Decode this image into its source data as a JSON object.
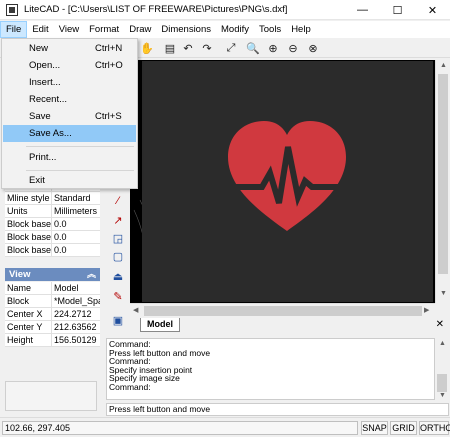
{
  "window": {
    "title": "LiteCAD - [C:\\Users\\LIST OF FREEWARE\\Pictures\\PNG\\s.dxf]",
    "minimize": "—",
    "maximize": "☐",
    "close": "✕"
  },
  "menubar": [
    "File",
    "Edit",
    "View",
    "Format",
    "Draw",
    "Dimensions",
    "Modify",
    "Tools",
    "Help"
  ],
  "file_menu": {
    "items": [
      {
        "label": "New",
        "shortcut": "Ctrl+N"
      },
      {
        "label": "Open...",
        "shortcut": "Ctrl+O"
      },
      {
        "label": "Insert...",
        "shortcut": ""
      },
      {
        "label": "Recent...",
        "shortcut": ""
      },
      {
        "label": "Save",
        "shortcut": "Ctrl+S"
      },
      {
        "label": "Save As...",
        "shortcut": ""
      },
      {
        "label": "Print...",
        "shortcut": ""
      },
      {
        "label": "Exit",
        "shortcut": ""
      }
    ],
    "highlighted": "Save As..."
  },
  "properties": {
    "rows_top": [
      {
        "key": "Mline style",
        "value": "Standard"
      },
      {
        "key": "Units",
        "value": "Millimeters"
      },
      {
        "key": "Block base",
        "value": "0.0"
      },
      {
        "key": "Block base",
        "value": "0.0"
      },
      {
        "key": "Block base",
        "value": "0.0"
      }
    ],
    "partial_top_value": "Standard",
    "view_section": {
      "title": "View",
      "rows": [
        {
          "key": "Name",
          "value": "Model"
        },
        {
          "key": "Block",
          "value": "*Model_Spa"
        },
        {
          "key": "Center X",
          "value": "224.2712"
        },
        {
          "key": "Center Y",
          "value": "212.63562"
        },
        {
          "key": "Height",
          "value": "156.50129"
        }
      ]
    }
  },
  "tabs": {
    "active": "Model",
    "close": "✕"
  },
  "command_log": [
    "Command:",
    "Press left button and move",
    "Command:",
    "Specify insertion point",
    "Specify image size",
    "Command:"
  ],
  "command_prompt": "Press left button and move",
  "statusbar": {
    "coords": "102.66,  297.405",
    "buttons": [
      "SNAP",
      "GRID",
      "ORTHO"
    ]
  },
  "colors": {
    "heart": "#d0393f",
    "canvas_bg": "#2b2b2b",
    "menu_highlight": "#91c9f7",
    "section_header": "#6b8cbf"
  }
}
